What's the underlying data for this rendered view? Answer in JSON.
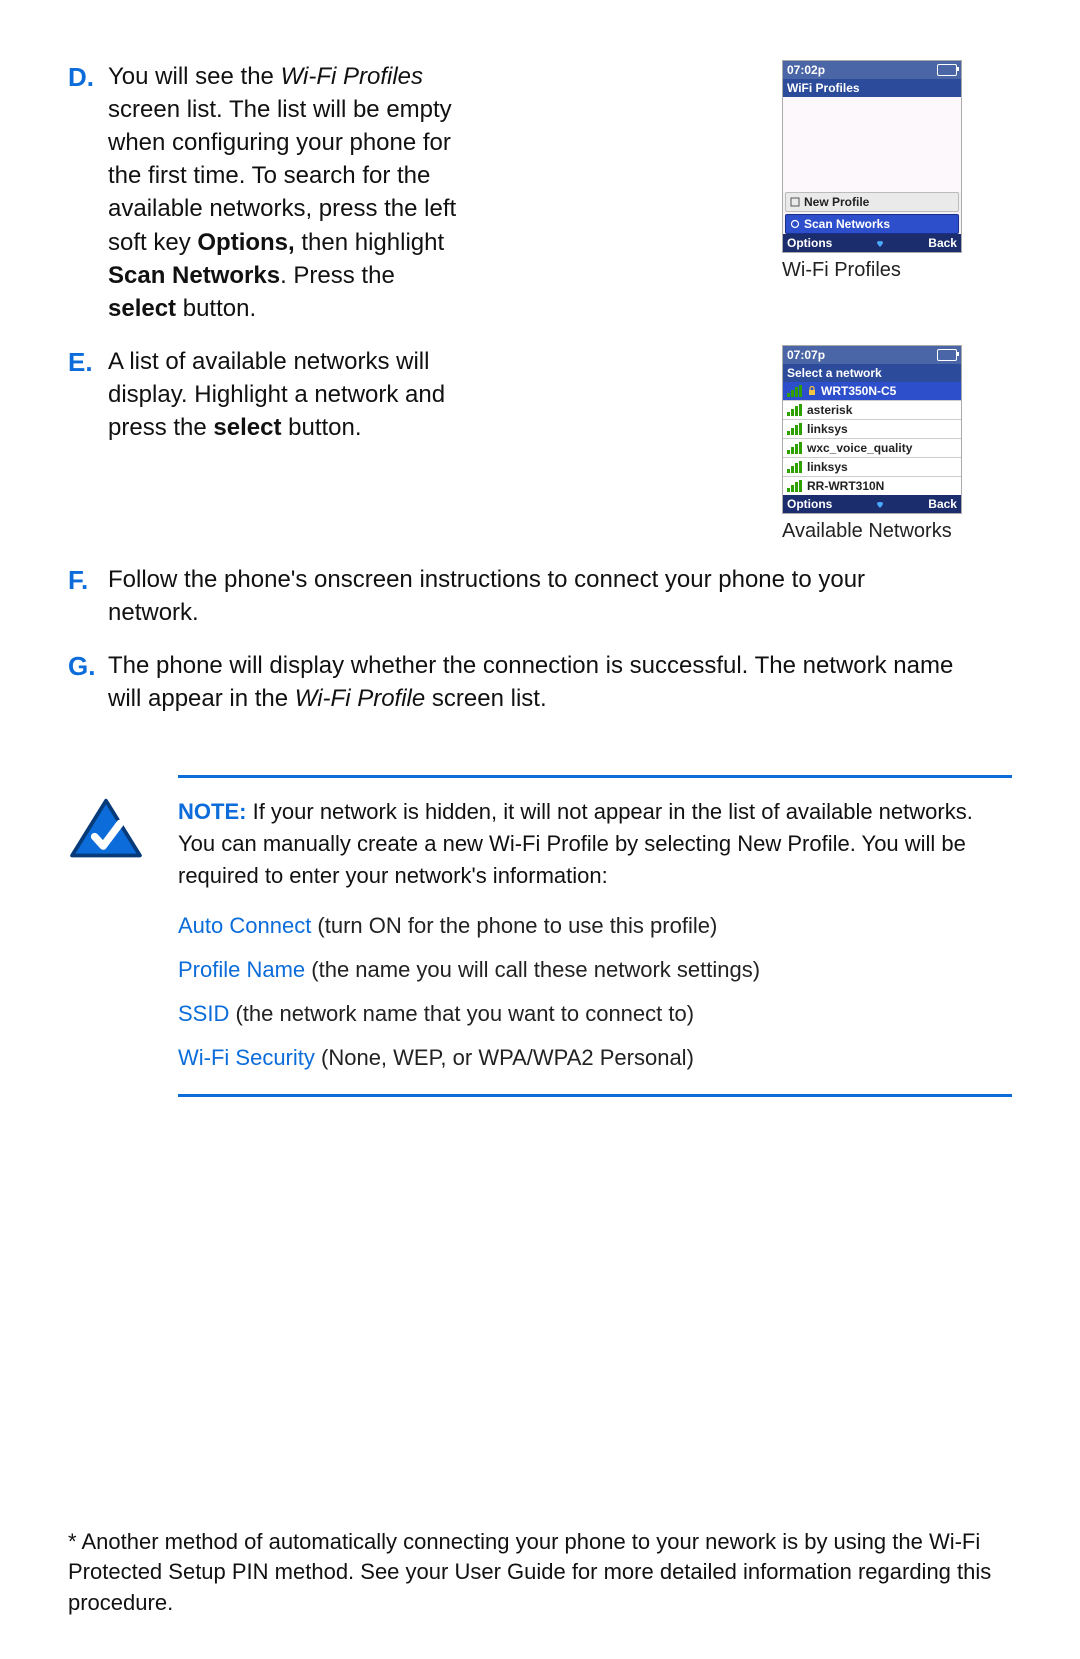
{
  "colors": {
    "accent": "#0b6cda",
    "phoneHeader": "#2d4b9b",
    "phoneHighlight": "#2d4fcb"
  },
  "steps": {
    "D": {
      "letter": "D.",
      "text_before_wifi": "You will see the ",
      "wifi_italic": "Wi-Fi Profiles",
      "text_mid1": " screen list. The list will be empty when configuring your phone for the first time.  To search for the available networks, press the left soft key ",
      "options_bold": "Options,",
      "text_mid2": " then highlight ",
      "scan_bold": "Scan Networks",
      "text_mid3": ". Press the ",
      "select_bold": "select",
      "text_after": " button."
    },
    "E": {
      "letter": "E.",
      "text_before": "A list of available networks will display.  Highlight a network and press the ",
      "select_bold": "select",
      "text_after": " button."
    },
    "F": {
      "letter": "F.",
      "text": "Follow the phone's onscreen instructions to connect your phone to your network."
    },
    "G": {
      "letter": "G.",
      "text_before": "The phone will display whether the connection is successful. The network name will appear in the ",
      "wifi_italic": "Wi-Fi Profile",
      "text_after": " screen list."
    }
  },
  "figures": {
    "wifi_profiles": {
      "time": "07:02p",
      "title": "WiFi Profiles",
      "menu": {
        "new_profile": "New Profile",
        "scan_networks": "Scan Networks"
      },
      "softkeys": {
        "left": "Options",
        "right": "Back"
      },
      "caption": "Wi-Fi Profiles"
    },
    "available_networks": {
      "time": "07:07p",
      "title": "Select a network",
      "items": [
        "WRT350N-C5",
        "asterisk",
        "linksys",
        "wxc_voice_quality",
        "linksys",
        "RR-WRT310N"
      ],
      "softkeys": {
        "left": "Options",
        "right": "Back"
      },
      "caption": "Available Networks"
    }
  },
  "note": {
    "label": "NOTE:",
    "text": "If your network is hidden, it will not appear in the list of available networks.  You can manually create a new Wi-Fi Profile by selecting New Profile.  You will be required to enter your network's information:",
    "fields": [
      {
        "label": "Auto Connect",
        "desc": " (turn ON for the phone to use this profile)"
      },
      {
        "label": "Profile Name",
        "desc": " (the name you will call these network settings)"
      },
      {
        "label": "SSID",
        "desc": " (the network name that you want to connect to)"
      },
      {
        "label": "Wi-Fi Security",
        "desc": " (None, WEP, or WPA/WPA2 Personal)"
      }
    ]
  },
  "footnote": "* Another method of automatically connecting your phone to your nework is by using the Wi-Fi Protected Setup PIN method. See your User Guide for more detailed information regarding this procedure."
}
